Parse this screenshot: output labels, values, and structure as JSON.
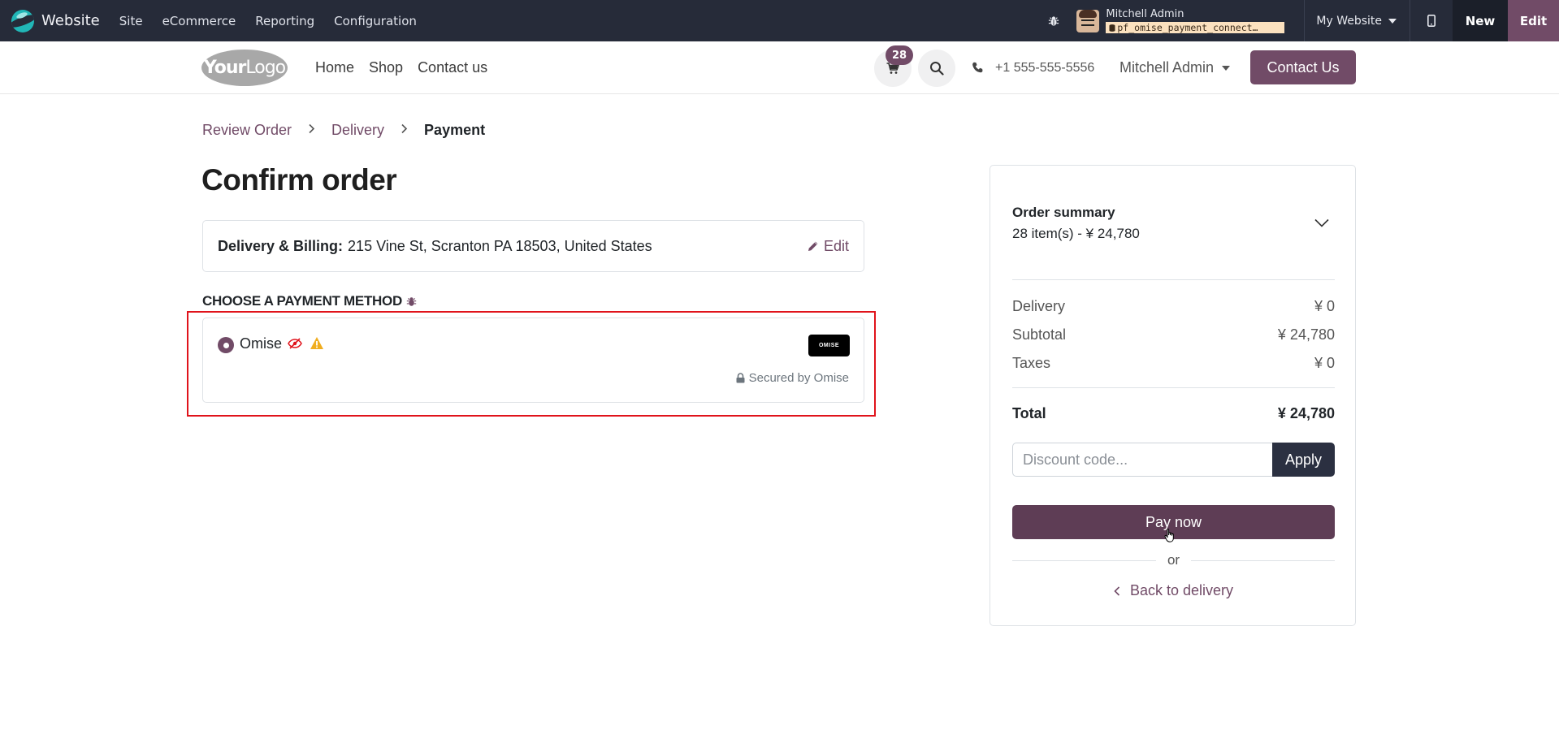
{
  "admin_bar": {
    "brand": "Website",
    "menu": [
      "Site",
      "eCommerce",
      "Reporting",
      "Configuration"
    ],
    "user_name": "Mitchell Admin",
    "database": "pf_omise_payment_connect…",
    "website_switcher": "My Website",
    "new_label": "New",
    "edit_label": "Edit"
  },
  "header": {
    "logo_bold": "Your",
    "logo_light": "Logo",
    "nav": [
      "Home",
      "Shop",
      "Contact us"
    ],
    "cart_count": "28",
    "phone": "+1 555-555-5556",
    "user_menu": "Mitchell Admin",
    "contact_button": "Contact Us"
  },
  "breadcrumb": {
    "step1": "Review Order",
    "step2": "Delivery",
    "step3": "Payment"
  },
  "main": {
    "title": "Confirm order",
    "address_label": "Delivery & Billing:",
    "address_value": "215 Vine St, Scranton PA 18503, United States",
    "edit_label": "Edit",
    "payment_title": "CHOOSE A PAYMENT METHOD",
    "payment_method": {
      "name": "Omise",
      "logo_text": "OMISE",
      "secured_text": "Secured by Omise"
    }
  },
  "summary": {
    "title": "Order summary",
    "subtitle": "28 item(s) -  ¥ 24,780",
    "rows": [
      {
        "label": "Delivery",
        "value": "¥ 0"
      },
      {
        "label": "Subtotal",
        "value": "¥ 24,780"
      },
      {
        "label": "Taxes",
        "value": "¥ 0"
      }
    ],
    "total_label": "Total",
    "total_value": "¥ 24,780",
    "discount_placeholder": "Discount code...",
    "apply_label": "Apply",
    "pay_label": "Pay now",
    "or_label": "or",
    "back_label": "Back to delivery"
  },
  "colors": {
    "brand_purple": "#714b67",
    "admin_bar": "#262b39",
    "highlight": "#e0131b",
    "warning": "#f0ad1f"
  }
}
